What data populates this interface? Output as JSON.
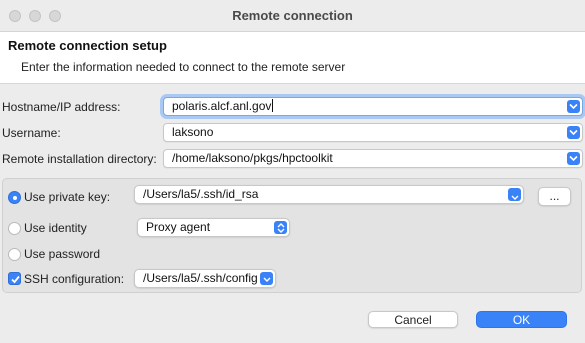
{
  "window": {
    "title": "Remote connection"
  },
  "header": {
    "title": "Remote connection setup",
    "description": "Enter the information needed to connect to the remote server"
  },
  "form": {
    "hostname": {
      "label": "Hostname/IP address:",
      "value": "polaris.alcf.anl.gov"
    },
    "username": {
      "label": "Username:",
      "value": "laksono"
    },
    "install_dir": {
      "label": "Remote installation directory:",
      "value": "/home/laksono/pkgs/hpctoolkit"
    }
  },
  "auth": {
    "private_key": {
      "label": "Use private key:",
      "value": "/Users/la5/.ssh/id_rsa",
      "selected": true,
      "browse_label": "..."
    },
    "identity": {
      "label": "Use identity",
      "value": "Proxy agent",
      "selected": false
    },
    "password": {
      "label": "Use password",
      "selected": false
    },
    "ssh_config": {
      "label": "SSH configuration:",
      "value": "/Users/la5/.ssh/config",
      "checked": true
    }
  },
  "buttons": {
    "cancel": "Cancel",
    "ok": "OK"
  },
  "colors": {
    "accent": "#3a82f7",
    "focus_ring": "#a9c8f3"
  }
}
